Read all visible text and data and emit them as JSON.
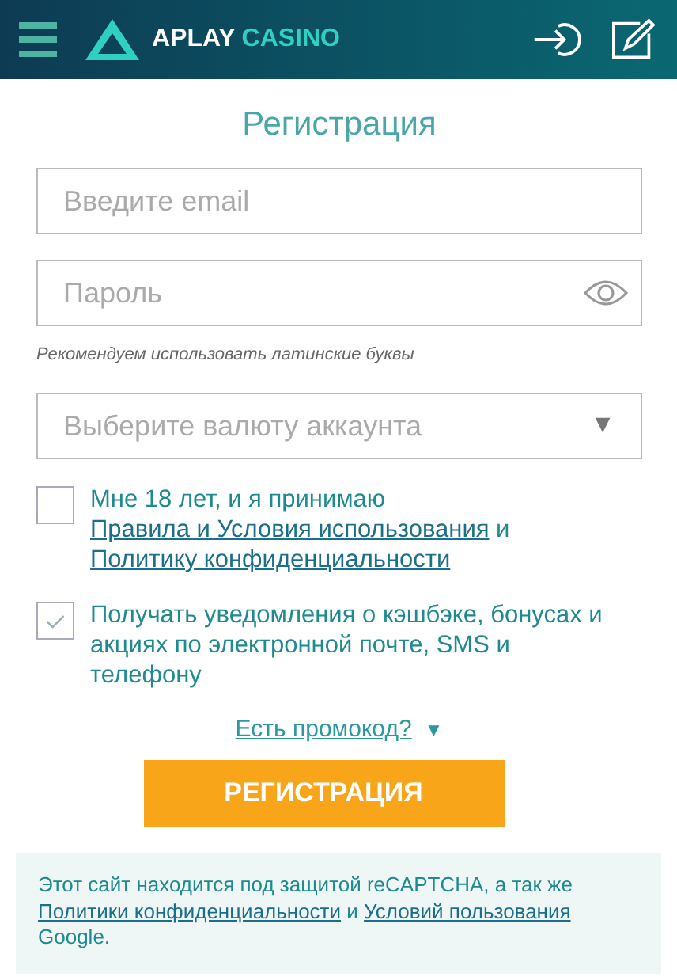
{
  "header": {
    "logo_first": "APLAY",
    "logo_second": "CASINO"
  },
  "title": "Регистрация",
  "email": {
    "placeholder": "Введите email"
  },
  "password": {
    "placeholder": "Пароль",
    "hint": "Рекомендуем использовать латинские буквы"
  },
  "currency": {
    "placeholder": "Выберите валюту аккаунта",
    "arrow": "▼"
  },
  "consents": [
    {
      "checked": false,
      "parts": [
        {
          "kind": "text",
          "text": "Мне 18 лет, и я принимаю "
        },
        {
          "kind": "link",
          "text": "Правила и Условия использования"
        },
        {
          "kind": "text",
          "text": " и "
        },
        {
          "kind": "link",
          "text": "Политику конфиденциальности"
        }
      ]
    },
    {
      "checked": true,
      "parts": [
        {
          "kind": "text",
          "text": "Получать уведомления о кэшбэке, бонусах и акциях по электронной почте, SMS и телефону"
        }
      ]
    }
  ],
  "promo": {
    "label": "Есть промокод?",
    "arrow": "▼"
  },
  "submit": "РЕГИСТРАЦИЯ",
  "footer": {
    "parts": [
      {
        "kind": "text",
        "text": "Этот сайт находится под защитой reCAPTCHA, а так же "
      },
      {
        "kind": "link",
        "text": "Политики конфиденциальности"
      },
      {
        "kind": "text",
        "text": " и "
      },
      {
        "kind": "link",
        "text": "Условий пользования"
      },
      {
        "kind": "text",
        "text": " Google."
      }
    ]
  }
}
